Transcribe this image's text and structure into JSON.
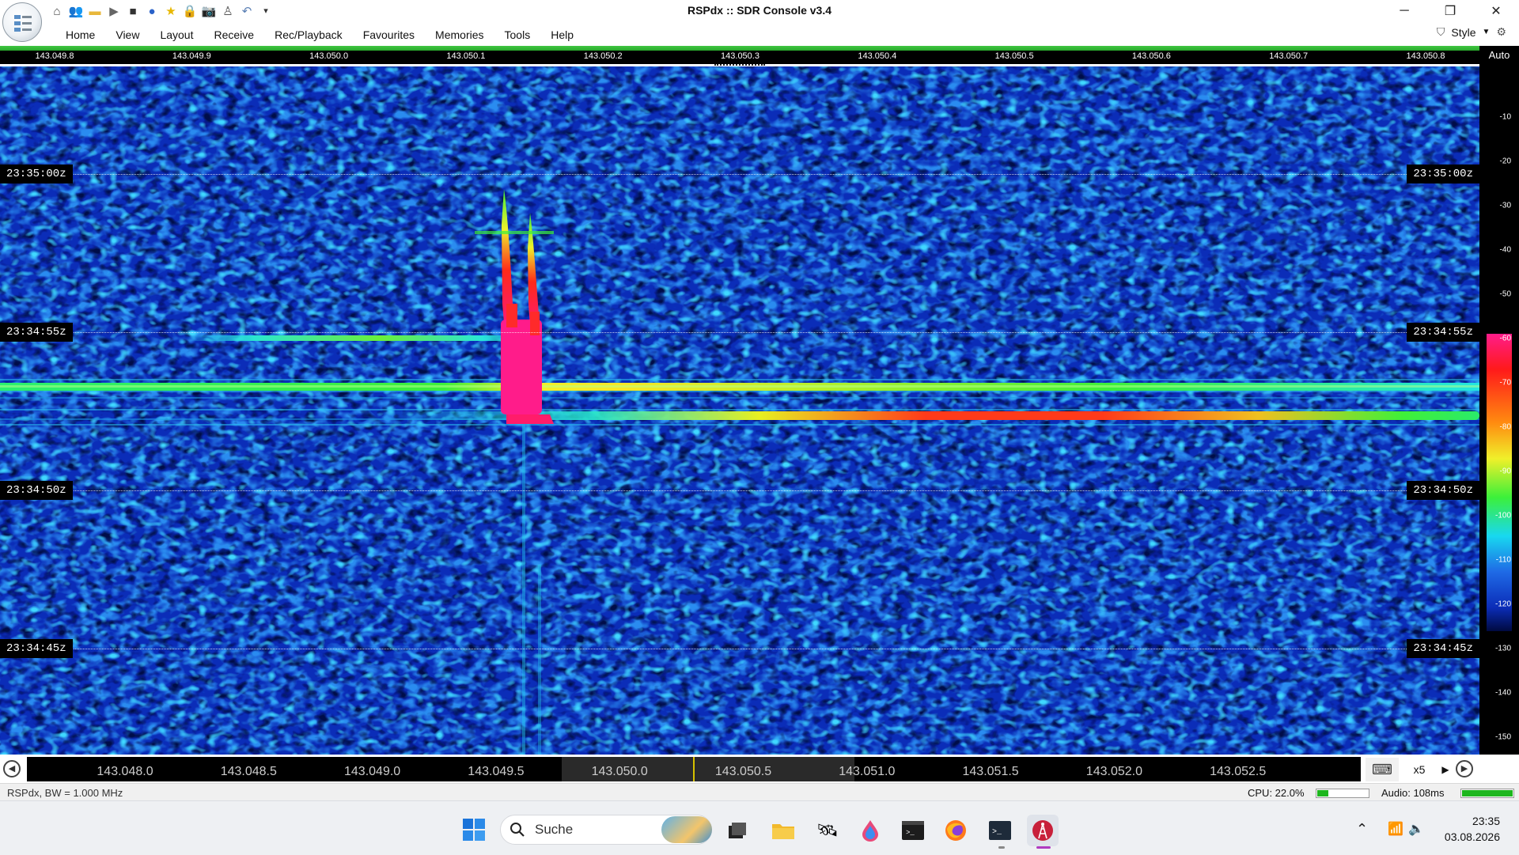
{
  "app": {
    "title": "RSPdx :: SDR Console v3.4",
    "orb_icon": "app-menu-orb-icon"
  },
  "qat": {
    "icons": [
      "home-icon",
      "users-icon",
      "folder-icon",
      "play-icon",
      "stop-icon",
      "record-icon",
      "star-icon",
      "lock-icon",
      "camera-icon",
      "satellite-icon",
      "undo-icon",
      "dropdown-icon"
    ]
  },
  "window_controls": {
    "minimize": "─",
    "restore": "❐",
    "close": "✕"
  },
  "menu": {
    "items": [
      "Home",
      "View",
      "Layout",
      "Receive",
      "Rec/Playback",
      "Favourites",
      "Memories",
      "Tools",
      "Help"
    ],
    "style_label": "Style"
  },
  "top_ruler": {
    "labels": [
      "143.049.8",
      "143.049.9",
      "143.050.0",
      "143.050.1",
      "143.050.2",
      "143.050.3",
      "143.050.4",
      "143.050.5",
      "143.050.6",
      "143.050.7",
      "143.050.8"
    ]
  },
  "waterfall": {
    "time_labels": [
      "23:35:00z",
      "23:34:55z",
      "23:34:50z",
      "23:34:45z"
    ],
    "colors": {
      "background": "#0b2db8",
      "noise_light": "#1e7fe6",
      "noise_dark": "#031566",
      "cyan": "#15d8f0",
      "green": "#3df03a",
      "yellow": "#f0f02a",
      "red": "#ff1a1a",
      "magenta": "#ff1c8a"
    }
  },
  "db_scale": {
    "mode_label": "Auto",
    "ticks": [
      "-10",
      "-20",
      "-30",
      "-40",
      "-50",
      "-60",
      "-70",
      "-80",
      "-90",
      "-100",
      "-110",
      "-120",
      "-130",
      "-140",
      "-150"
    ]
  },
  "bottom_ruler": {
    "labels": [
      "143.048.0",
      "143.048.5",
      "143.049.0",
      "143.049.5",
      "143.050.0",
      "143.050.5",
      "143.051.0",
      "143.051.5",
      "143.052.0",
      "143.052.5"
    ],
    "zoom": "x5"
  },
  "status": {
    "left": "RSPdx, BW = 1.000 MHz",
    "cpu": "CPU: 22.0%",
    "cpu_fraction": 0.22,
    "audio": "Audio: 108ms",
    "audio_fraction": 1.0
  },
  "taskbar": {
    "search_placeholder": "Suche",
    "apps": [
      "start-icon",
      "file-manager-icon",
      "folder-icon",
      "satellite-app-icon",
      "droplet-app-icon",
      "terminal-icon",
      "firefox-icon",
      "powershell-icon",
      "sdr-console-icon"
    ],
    "time": "23:35",
    "date": "03.08.2026"
  }
}
